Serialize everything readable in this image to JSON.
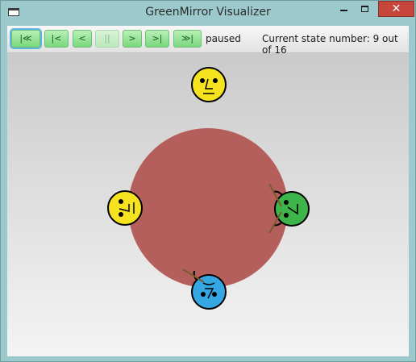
{
  "window": {
    "title": "GreenMirror Visualizer",
    "close_glyph": "✕"
  },
  "toolbar": {
    "buttons": [
      {
        "name": "first-state-button",
        "label": "|≪",
        "enabled": true,
        "focused": true
      },
      {
        "name": "previous-transition-button",
        "label": "|<",
        "enabled": true
      },
      {
        "name": "step-back-button",
        "label": "<",
        "enabled": true
      },
      {
        "name": "pause-button",
        "label": "||",
        "enabled": false
      },
      {
        "name": "step-forward-button",
        "label": ">",
        "enabled": true
      },
      {
        "name": "next-transition-button",
        "label": ">|",
        "enabled": true
      },
      {
        "name": "last-state-button",
        "label": "≫|",
        "enabled": true
      }
    ],
    "playback_status": "paused",
    "state_counter": "Current state number: 9 out of 16"
  },
  "scene": {
    "table_color": "#b45f5b",
    "philosophers": [
      {
        "name": "philosopher-top",
        "color": "#f4e31e",
        "state": "neutral",
        "face": "·L·"
      },
      {
        "name": "philosopher-left",
        "color": "#f4e31e",
        "state": "neutral",
        "face": "·L·"
      },
      {
        "name": "philosopher-right",
        "color": "#3db54a",
        "state": "eating",
        "face": "·7·"
      },
      {
        "name": "philosopher-bottom",
        "color": "#35a7e3",
        "state": "holding-fork",
        "face": "·7·"
      }
    ]
  }
}
